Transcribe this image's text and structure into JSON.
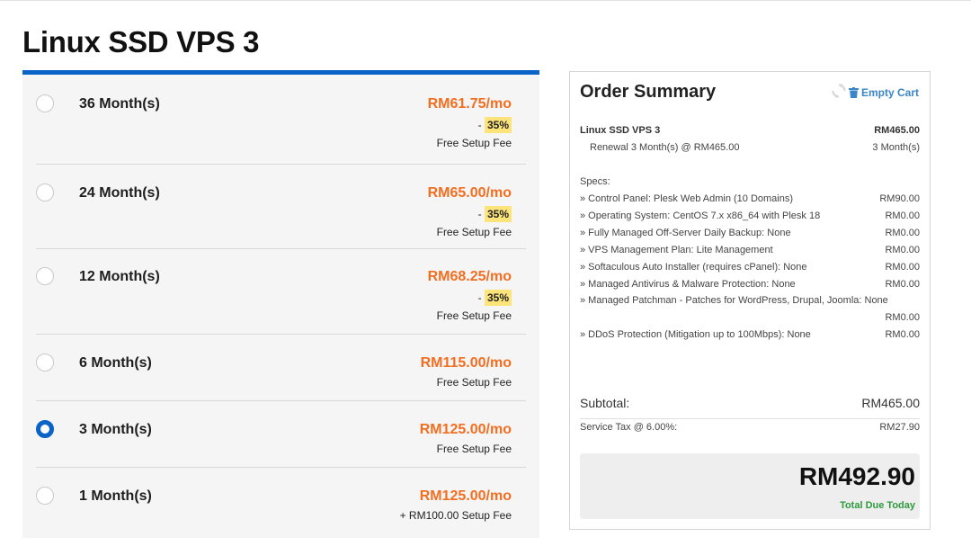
{
  "page_title": "Linux SSD VPS 3",
  "colors": {
    "accent_blue": "#0a64c8",
    "price_orange": "#f26e21",
    "discount_yellow": "#fde47a",
    "total_green": "#2e9a3e",
    "link_blue": "#3a86c8"
  },
  "billing_options": [
    {
      "period": "36 Month(s)",
      "price": "RM61.75/mo",
      "discount_prefix": "- ",
      "discount": "35%",
      "setup": "Free Setup Fee",
      "selected": false
    },
    {
      "period": "24 Month(s)",
      "price": "RM65.00/mo",
      "discount_prefix": "- ",
      "discount": "35%",
      "setup": "Free Setup Fee",
      "selected": false
    },
    {
      "period": "12 Month(s)",
      "price": "RM68.25/mo",
      "discount_prefix": "- ",
      "discount": "35%",
      "setup": "Free Setup Fee",
      "selected": false
    },
    {
      "period": "6 Month(s)",
      "price": "RM115.00/mo",
      "setup": "Free Setup Fee",
      "selected": false
    },
    {
      "period": "3 Month(s)",
      "price": "RM125.00/mo",
      "setup": "Free Setup Fee",
      "selected": true
    },
    {
      "period": "1 Month(s)",
      "price": "RM125.00/mo",
      "setup": "+ RM100.00 Setup Fee",
      "selected": false
    }
  ],
  "summary": {
    "title": "Order Summary",
    "refresh_icon": "refresh-icon",
    "empty_cart_icon": "trash-icon",
    "empty_cart_label": "Empty Cart",
    "product_name": "Linux SSD VPS 3",
    "product_price": "RM465.00",
    "renewal_label": "Renewal 3 Month(s) @ RM465.00",
    "renewal_cycle": "3 Month(s)",
    "specs_label": "Specs:",
    "specs": [
      {
        "label": "» Control Panel: Plesk Web Admin (10 Domains)",
        "price": "RM90.00"
      },
      {
        "label": "» Operating System: CentOS 7.x x86_64 with Plesk 18",
        "price": "RM0.00"
      },
      {
        "label": "» Fully Managed Off-Server Daily Backup: None",
        "price": "RM0.00"
      },
      {
        "label": "» VPS Management Plan: Lite Management",
        "price": "RM0.00"
      },
      {
        "label": "» Softaculous Auto Installer (requires cPanel): None",
        "price": "RM0.00"
      },
      {
        "label": "» Managed Antivirus & Malware Protection: None",
        "price": "RM0.00"
      },
      {
        "label": "» Managed Patchman - Patches for WordPress, Drupal, Joomla: None",
        "price": "RM0.00"
      },
      {
        "label": "» DDoS Protection (Mitigation up to 100Mbps): None",
        "price": "RM0.00"
      }
    ],
    "subtotal_label": "Subtotal:",
    "subtotal_value": "RM465.00",
    "tax_label": "Service Tax @ 6.00%:",
    "tax_value": "RM27.90",
    "total_value": "RM492.90",
    "total_label": "Total Due Today"
  }
}
